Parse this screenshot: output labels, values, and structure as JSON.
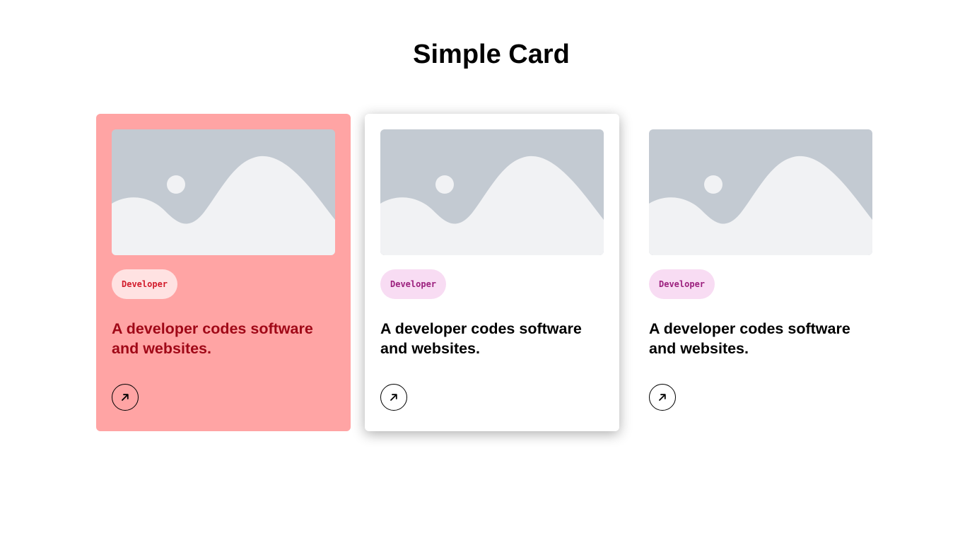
{
  "page": {
    "title": "Simple Card"
  },
  "cards": [
    {
      "tag": "Developer",
      "heading": "A developer codes software and websites.",
      "image_icon": "image-placeholder-icon",
      "button_icon": "arrow-up-right-icon"
    },
    {
      "tag": "Developer",
      "heading": "A developer codes software and websites.",
      "image_icon": "image-placeholder-icon",
      "button_icon": "arrow-up-right-icon"
    },
    {
      "tag": "Developer",
      "heading": "A developer codes software and websites.",
      "image_icon": "image-placeholder-icon",
      "button_icon": "arrow-up-right-icon"
    }
  ],
  "colors": {
    "card_active_bg": "#ffa4a4",
    "card_active_text": "#a00817",
    "tag_active_bg": "#ffe2e2",
    "tag_active_text": "#d21b2b",
    "tag_default_bg": "#f8dcf3",
    "tag_default_text": "#9b1f7d",
    "placeholder_bg": "#c3cad2",
    "placeholder_fg": "#f1f2f4"
  }
}
